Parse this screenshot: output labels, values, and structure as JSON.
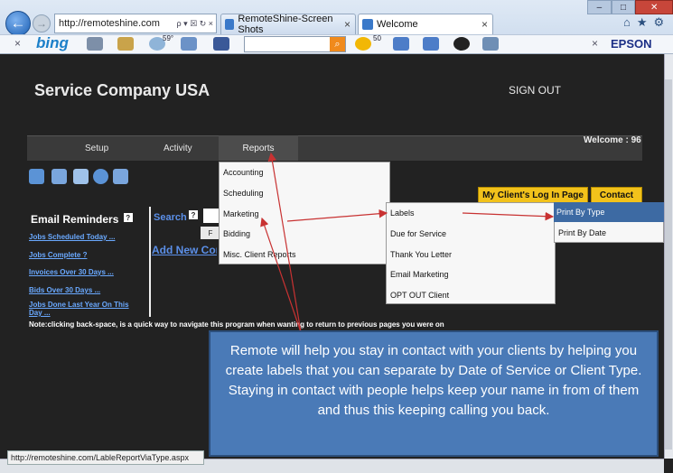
{
  "browser": {
    "url": "http://remoteshine.com",
    "address_icons": "ρ ▾ ☒ ↻ ×",
    "tabs": [
      {
        "label": "RemoteShine-Screen Shots",
        "close": "×"
      },
      {
        "label": "Welcome",
        "close": "×"
      }
    ],
    "window_buttons": [
      "–",
      "□",
      "✕"
    ],
    "tool_icons": [
      "⌂",
      "★",
      "⚙"
    ],
    "back_glyph": "←",
    "forward_glyph": "→"
  },
  "toolbar": {
    "close_left": "×",
    "brand": "bing",
    "weather": "59°",
    "badge": "50",
    "search_glyph": "⌕",
    "close_right": "×",
    "epson": "EPSON"
  },
  "page": {
    "company": "Service Company USA",
    "sign_out": "SIGN OUT",
    "welcome": "Welcome : 96",
    "nav": {
      "setup": "Setup",
      "activity": "Activity",
      "reports": "Reports"
    },
    "buttons": {
      "client_login": "My Client's Log In Page",
      "contact": "Contact"
    },
    "reminders": {
      "title": "Email Reminders",
      "help": "?",
      "links": [
        "Jobs Scheduled Today ...",
        "Jobs Complete ?",
        "Invoices Over 30 Days ...",
        "Bids Over 30 Days ...",
        "Jobs Done Last Year On This Day ..."
      ]
    },
    "search_label": "Search",
    "search_help": "?",
    "search_button": "F",
    "add_new": "Add New Con",
    "note": "Note:clicking back-space, is a quick way to navigate this program when wanting to return to previous pages you were on"
  },
  "menus": {
    "reports": [
      "Accounting",
      "Scheduling",
      "Marketing",
      "Bidding",
      "Misc. Client Reports"
    ],
    "marketing": [
      "Labels",
      "Due for Service",
      "Thank You Letter",
      "Email Marketing",
      "OPT OUT Client"
    ],
    "labels": [
      "Print By Type",
      "Print By Date"
    ]
  },
  "callout": "Remote will help you stay in contact with your clients by helping you create labels that you can separate by Date of Service or Client Type. Staying in contact with people helps keep your name in from of them and thus this keeping calling you back.",
  "status_url": "http://remoteshine.com/LableReportViaType.aspx"
}
